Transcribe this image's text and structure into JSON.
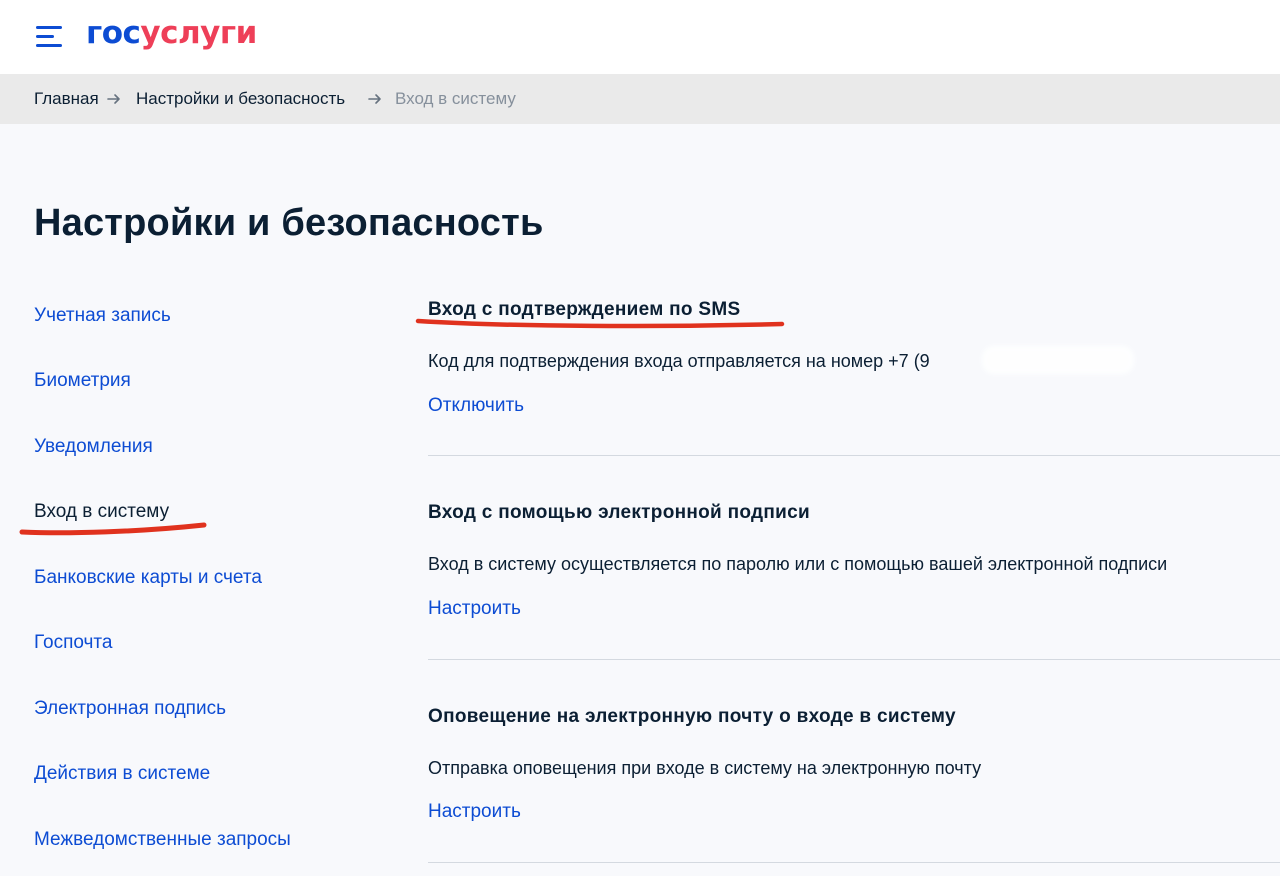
{
  "header": {
    "logo_part1": "гос",
    "logo_part2": "услуги",
    "brand_colors": {
      "blue": "#0d4cd3",
      "red": "#ee3f58"
    },
    "menu_icon": "hamburger-icon"
  },
  "breadcrumb": {
    "items": [
      "Главная",
      "Настройки и безопасность",
      "Вход в систему"
    ],
    "separator_icon": "arrow-right-icon"
  },
  "page": {
    "title": "Настройки и безопасность"
  },
  "sidebar": {
    "items": [
      {
        "label": "Учетная запись",
        "active": false
      },
      {
        "label": "Биометрия",
        "active": false
      },
      {
        "label": "Уведомления",
        "active": false
      },
      {
        "label": "Вход в систему",
        "active": true
      },
      {
        "label": "Банковские карты и счета",
        "active": false
      },
      {
        "label": "Госпочта",
        "active": false
      },
      {
        "label": "Электронная подпись",
        "active": false
      },
      {
        "label": "Действия в системе",
        "active": false
      },
      {
        "label": "Межведомственные запросы",
        "active": false
      }
    ]
  },
  "sections": [
    {
      "title": "Вход с подтверждением по SMS",
      "description": "Код для подтверждения входа отправляется на номер +7 (9",
      "action": "Отключить"
    },
    {
      "title": "Вход с помощью электронной подписи",
      "description": "Вход в систему осуществляется по паролю или с помощью вашей электронной подписи",
      "action": "Настроить"
    },
    {
      "title": "Оповещение на электронную почту о входе в систему",
      "description": "Отправка оповещения при входе в систему на электронную почту",
      "action": "Настроить"
    }
  ],
  "annotation_color": "#e0321e"
}
